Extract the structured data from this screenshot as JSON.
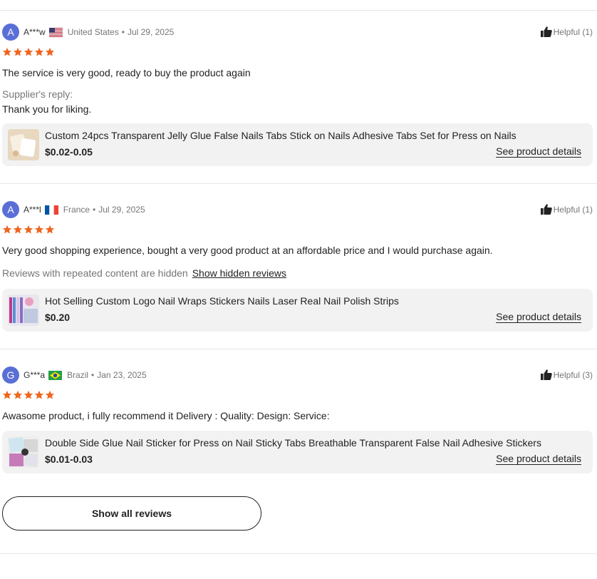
{
  "reviews": [
    {
      "avatar_letter": "A",
      "username": "A***w",
      "country": "United States",
      "date": "Jul 29, 2025",
      "helpful_label": "Helpful (1)",
      "rating": 5,
      "text": "The service is very good, ready to buy the product again",
      "reply_label": "Supplier's reply:",
      "reply_text": "Thank you for liking.",
      "product": {
        "title": "Custom 24pcs Transparent Jelly Glue False Nails Tabs Stick on Nails Adhesive Tabs Set for Press on Nails",
        "price": "$0.02-0.05",
        "details_label": "See product details"
      }
    },
    {
      "avatar_letter": "A",
      "username": "A***l",
      "country": "France",
      "date": "Jul 29, 2025",
      "helpful_label": "Helpful (1)",
      "rating": 5,
      "text": "Very good shopping experience, bought a very good product at an affordable price and I would purchase again.",
      "hidden_note": "Reviews with repeated content are hidden",
      "hidden_link": "Show hidden reviews",
      "product": {
        "title": "Hot Selling Custom Logo Nail Wraps Stickers Nails Laser Real Nail Polish Strips",
        "price": "$0.20",
        "details_label": "See product details"
      }
    },
    {
      "avatar_letter": "G",
      "username": "G***a",
      "country": "Brazil",
      "date": "Jan 23, 2025",
      "helpful_label": "Helpful (3)",
      "rating": 5,
      "text": "Awasome product, i fully recommend it Delivery :  Quality:  Design:  Service:",
      "product": {
        "title": "Double Side Glue Nail Sticker for Press on Nail Sticky Tabs Breathable Transparent False Nail Adhesive Stickers",
        "price": "$0.01-0.03",
        "details_label": "See product details"
      }
    }
  ],
  "show_all_label": "Show all reviews",
  "colors": {
    "star": "#f0651f",
    "avatar": "#5a6fd6"
  },
  "icons": {
    "helpful": "thumbs-up-icon",
    "star": "star-icon"
  }
}
